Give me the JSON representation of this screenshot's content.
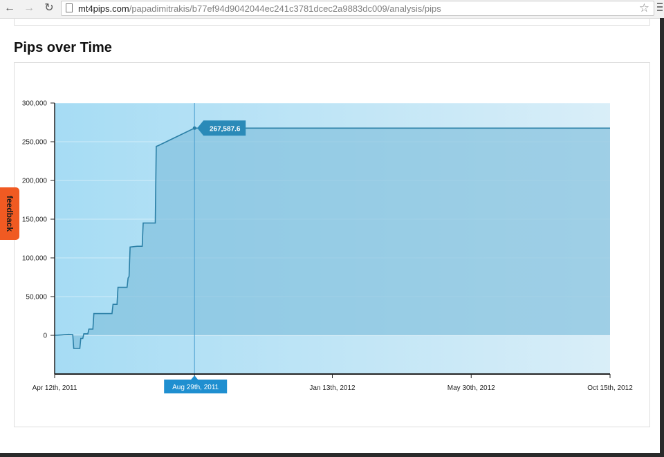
{
  "browser": {
    "url_host": "mt4pips.com",
    "url_path": "/papadimitrakis/b77ef94d9042044ec241c3781dcec2a9883dc009/analysis/pips"
  },
  "page": {
    "title": "Pips over Time",
    "feedback_label": "feedback"
  },
  "chart_data": {
    "type": "area",
    "title": "Pips over Time",
    "xlabel": "",
    "ylabel": "",
    "ylim": [
      -50000,
      300000
    ],
    "xlim": [
      "2011-04-12",
      "2012-10-15"
    ],
    "yticks": [
      {
        "value": 300000,
        "label": "300,000"
      },
      {
        "value": 250000,
        "label": "250,000"
      },
      {
        "value": 200000,
        "label": "200,000"
      },
      {
        "value": 150000,
        "label": "150,000"
      },
      {
        "value": 100000,
        "label": "100,000"
      },
      {
        "value": 50000,
        "label": "50,000"
      },
      {
        "value": 0,
        "label": "0"
      }
    ],
    "xticks": [
      {
        "date": "2011-04-12",
        "label": "Apr 12th, 2011"
      },
      {
        "date": "2011-08-29",
        "label": "Aug 29th, 2011"
      },
      {
        "date": "2012-01-13",
        "label": "Jan 13th, 2012"
      },
      {
        "date": "2012-05-30",
        "label": "May 30th, 2012"
      },
      {
        "date": "2012-10-15",
        "label": "Oct 15th, 2012"
      }
    ],
    "grid": true,
    "series": [
      {
        "points": [
          [
            "2011-04-12",
            0
          ],
          [
            "2011-04-19",
            500
          ],
          [
            "2011-04-26",
            1200
          ],
          [
            "2011-04-30",
            800
          ],
          [
            "2011-05-01",
            -17000
          ],
          [
            "2011-05-07",
            -17000
          ],
          [
            "2011-05-08",
            -4000
          ],
          [
            "2011-05-10",
            -4000
          ],
          [
            "2011-05-11",
            2000
          ],
          [
            "2011-05-15",
            2000
          ],
          [
            "2011-05-16",
            8000
          ],
          [
            "2011-05-20",
            8000
          ],
          [
            "2011-05-21",
            28000
          ],
          [
            "2011-06-01",
            28000
          ],
          [
            "2011-06-02",
            28000
          ],
          [
            "2011-06-08",
            28000
          ],
          [
            "2011-06-09",
            40000
          ],
          [
            "2011-06-13",
            40000
          ],
          [
            "2011-06-14",
            62000
          ],
          [
            "2011-06-20",
            62000
          ],
          [
            "2011-06-23",
            62000
          ],
          [
            "2011-06-24",
            74000
          ],
          [
            "2011-06-25",
            76000
          ],
          [
            "2011-06-26",
            114000
          ],
          [
            "2011-07-03",
            115000
          ],
          [
            "2011-07-08",
            115000
          ],
          [
            "2011-07-09",
            145000
          ],
          [
            "2011-07-21",
            145000
          ],
          [
            "2011-07-22",
            244000
          ],
          [
            "2011-07-24",
            245000
          ],
          [
            "2011-08-29",
            267587.6
          ],
          [
            "2012-10-15",
            267587.6
          ]
        ]
      }
    ],
    "crosshair": {
      "date": "2011-08-29",
      "x_label": "Aug 29th, 2011",
      "value": 267587.6,
      "value_label": "267,587.6"
    },
    "colors": {
      "line": "#2a7fa6",
      "fill": "#7fbfdc",
      "background_left": "#a6dcf4",
      "background_right": "#d9eef8",
      "tooltip": "#2a8ab8",
      "x_label_box": "#1f8fd0"
    }
  }
}
